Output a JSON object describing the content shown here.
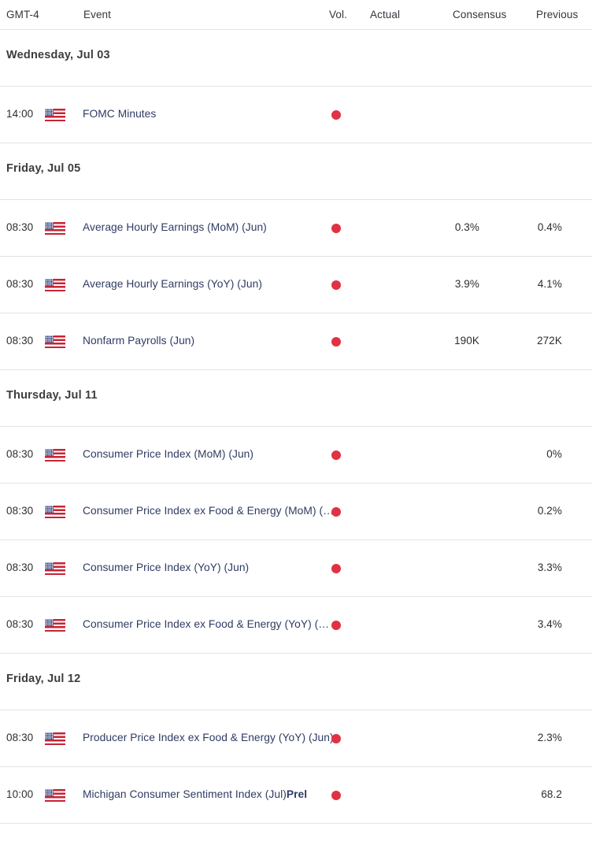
{
  "header": {
    "timezone": "GMT-4",
    "event": "Event",
    "vol": "Vol.",
    "actual": "Actual",
    "consensus": "Consensus",
    "previous": "Previous"
  },
  "colors": {
    "volatility_high": "#e03244",
    "event_link": "#2f3b63",
    "divider": "#e3e3e3",
    "text": "#2d2d2d"
  },
  "sections": [
    {
      "date": "Wednesday, Jul 03",
      "rows": [
        {
          "time": "14:00",
          "country": "United States",
          "flag": "us-flag-icon",
          "event": "FOMC Minutes",
          "prel": "",
          "volatility": "high",
          "actual": "",
          "consensus": "",
          "previous": ""
        }
      ]
    },
    {
      "date": "Friday, Jul 05",
      "rows": [
        {
          "time": "08:30",
          "country": "United States",
          "flag": "us-flag-icon",
          "event": "Average Hourly Earnings (MoM) (Jun)",
          "prel": "",
          "volatility": "high",
          "actual": "",
          "consensus": "0.3%",
          "previous": "0.4%"
        },
        {
          "time": "08:30",
          "country": "United States",
          "flag": "us-flag-icon",
          "event": "Average Hourly Earnings (YoY) (Jun)",
          "prel": "",
          "volatility": "high",
          "actual": "",
          "consensus": "3.9%",
          "previous": "4.1%"
        },
        {
          "time": "08:30",
          "country": "United States",
          "flag": "us-flag-icon",
          "event": "Nonfarm Payrolls (Jun)",
          "prel": "",
          "volatility": "high",
          "actual": "",
          "consensus": "190K",
          "previous": "272K"
        }
      ]
    },
    {
      "date": "Thursday, Jul 11",
      "rows": [
        {
          "time": "08:30",
          "country": "United States",
          "flag": "us-flag-icon",
          "event": "Consumer Price Index (MoM) (Jun)",
          "prel": "",
          "volatility": "high",
          "actual": "",
          "consensus": "",
          "previous": "0%"
        },
        {
          "time": "08:30",
          "country": "United States",
          "flag": "us-flag-icon",
          "event": "Consumer Price Index ex Food & Energy (MoM) (Jun)",
          "prel": "",
          "volatility": "high",
          "actual": "",
          "consensus": "",
          "previous": "0.2%"
        },
        {
          "time": "08:30",
          "country": "United States",
          "flag": "us-flag-icon",
          "event": "Consumer Price Index (YoY) (Jun)",
          "prel": "",
          "volatility": "high",
          "actual": "",
          "consensus": "",
          "previous": "3.3%"
        },
        {
          "time": "08:30",
          "country": "United States",
          "flag": "us-flag-icon",
          "event": "Consumer Price Index ex Food & Energy (YoY) (Jun)",
          "prel": "",
          "volatility": "high",
          "actual": "",
          "consensus": "",
          "previous": "3.4%"
        }
      ]
    },
    {
      "date": "Friday, Jul 12",
      "rows": [
        {
          "time": "08:30",
          "country": "United States",
          "flag": "us-flag-icon",
          "event": "Producer Price Index ex Food & Energy (YoY) (Jun)",
          "prel": "",
          "volatility": "high",
          "actual": "",
          "consensus": "",
          "previous": "2.3%"
        },
        {
          "time": "10:00",
          "country": "United States",
          "flag": "us-flag-icon",
          "event": "Michigan Consumer Sentiment Index (Jul)",
          "prel": "Prel",
          "volatility": "high",
          "actual": "",
          "consensus": "",
          "previous": "68.2"
        }
      ]
    }
  ]
}
